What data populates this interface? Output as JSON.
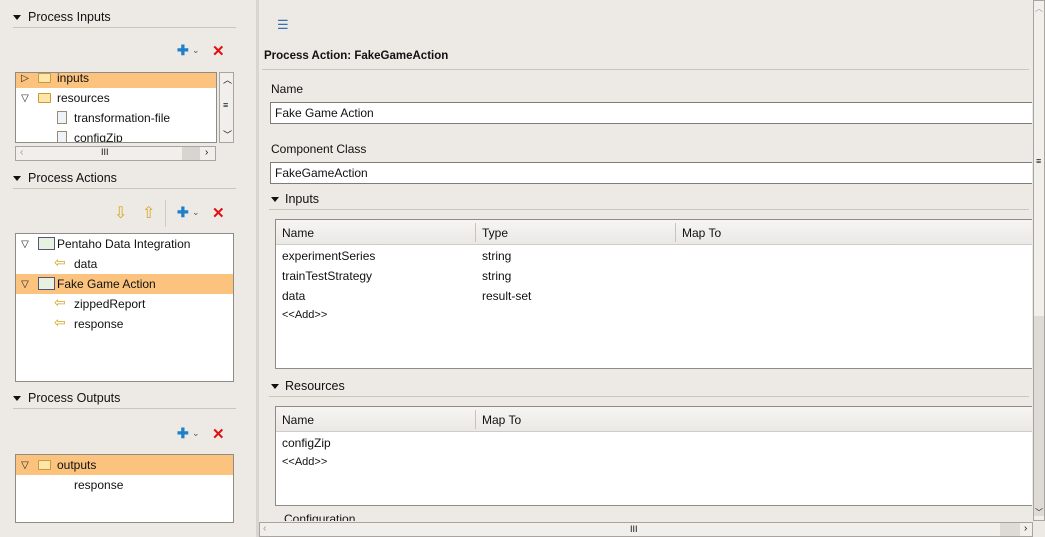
{
  "left": {
    "inputs": {
      "title": "Process Inputs",
      "items": [
        {
          "label": "inputs",
          "selected": true,
          "icon": "folder-icon",
          "expanded": false
        },
        {
          "label": "resources",
          "icon": "folder-icon",
          "expanded": true
        },
        {
          "label": "transformation-file",
          "icon": "file-icon"
        },
        {
          "label": "configZip",
          "icon": "file-icon"
        }
      ]
    },
    "actions": {
      "title": "Process Actions",
      "items": [
        {
          "label": "Pentaho Data Integration",
          "icon": "action-icon"
        },
        {
          "label": "data",
          "icon": "output-arrow-icon"
        },
        {
          "label": "Fake Game Action",
          "icon": "action-icon",
          "selected": true
        },
        {
          "label": "zippedReport",
          "icon": "output-arrow-icon"
        },
        {
          "label": "response",
          "icon": "output-arrow-icon"
        }
      ]
    },
    "outputs": {
      "title": "Process Outputs",
      "items": [
        {
          "label": "outputs",
          "icon": "folder-icon",
          "selected": true
        },
        {
          "label": "response"
        }
      ]
    }
  },
  "main": {
    "title": "Process Action: FakeGameAction",
    "name_label": "Name",
    "name_value": "Fake Game Action",
    "class_label": "Component Class",
    "class_value": "FakeGameAction",
    "inputs": {
      "title": "Inputs",
      "columns": [
        "Name",
        "Type",
        "Map To"
      ],
      "rows": [
        [
          "experimentSeries",
          "string",
          ""
        ],
        [
          "trainTestStrategy",
          "string",
          ""
        ],
        [
          "data",
          "result-set",
          ""
        ]
      ],
      "add": "<<Add>>"
    },
    "resources": {
      "title": "Resources",
      "columns": [
        "Name",
        "Map To"
      ],
      "rows": [
        [
          "configZip",
          ""
        ]
      ],
      "add": "<<Add>>"
    },
    "configuration": {
      "title": "Configuration"
    }
  },
  "colors": {
    "selection": "#fbc37e",
    "background": "#edeae5",
    "delete": "#e01010",
    "add": "#1f7fc8"
  }
}
